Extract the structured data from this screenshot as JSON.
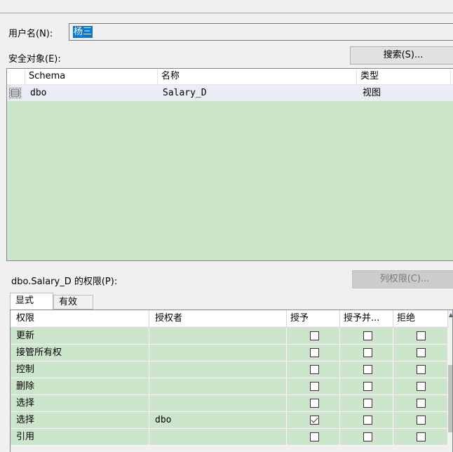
{
  "user": {
    "label": "用户名(N):",
    "value": "杨三"
  },
  "securables": {
    "label": "安全对象(E):",
    "search_button": "搜索(S)...",
    "columns": [
      "Schema",
      "名称",
      "类型"
    ],
    "rows": [
      {
        "schema": "dbo",
        "name": "Salary_D",
        "type": "视图"
      }
    ]
  },
  "permissions": {
    "label": "dbo.Salary_D 的权限(P):",
    "column_permissions_button": "列权限(C)...",
    "tabs": [
      "显式",
      "有效"
    ],
    "columns": [
      "权限",
      "授权者",
      "授予",
      "授予并...",
      "拒绝"
    ],
    "rows": [
      {
        "permission": "更新",
        "grantor": "",
        "grant": false,
        "with_grant": false,
        "deny": false
      },
      {
        "permission": "接管所有权",
        "grantor": "",
        "grant": false,
        "with_grant": false,
        "deny": false
      },
      {
        "permission": "控制",
        "grantor": "",
        "grant": false,
        "with_grant": false,
        "deny": false
      },
      {
        "permission": "删除",
        "grantor": "",
        "grant": false,
        "with_grant": false,
        "deny": false
      },
      {
        "permission": "选择",
        "grantor": "",
        "grant": false,
        "with_grant": false,
        "deny": false
      },
      {
        "permission": "选择",
        "grantor": "dbo",
        "grant": true,
        "with_grant": false,
        "deny": false
      },
      {
        "permission": "引用",
        "grantor": "",
        "grant": false,
        "with_grant": false,
        "deny": false
      }
    ]
  },
  "icons": {
    "row_icon": "table-view-icon"
  }
}
